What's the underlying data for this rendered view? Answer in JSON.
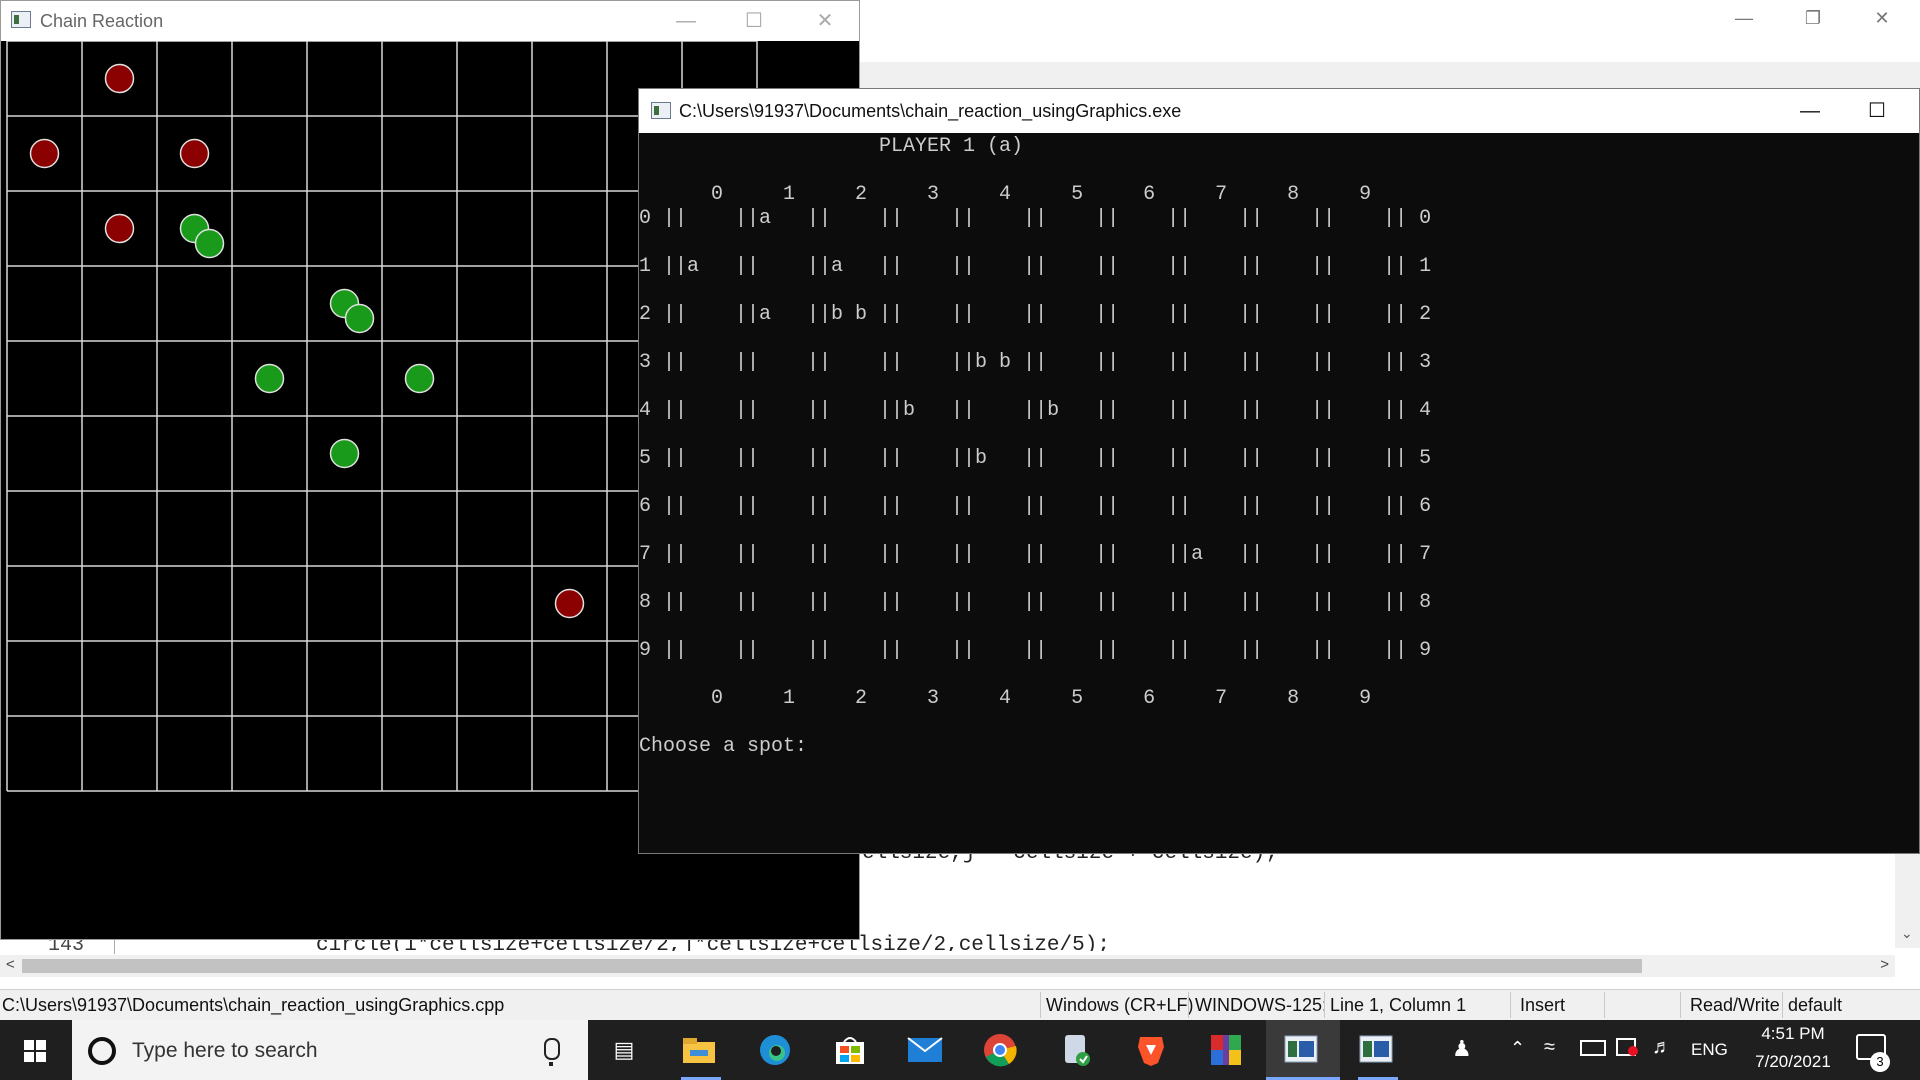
{
  "ide": {
    "code_fragment_top": "ellsize,j * cellsize + cellsize);",
    "code_line_number": "143",
    "code_fragment_bottom": "circle(i*cellsize+cellsize/2,j*cellsize+cellsize/2,cellsize/5);",
    "status": {
      "file_path": "C:\\Users\\91937\\Documents\\chain_reaction_usingGraphics.cpp",
      "line_endings": "Windows (CR+LF)",
      "encoding": "WINDOWS-125:",
      "position": "Line 1, Column 1",
      "mode": "Insert",
      "access": "Read/Write",
      "profile": "default"
    }
  },
  "game_window": {
    "title": "Chain Reaction",
    "grid_size": 10,
    "colors": {
      "background": "#000000",
      "grid": "#d8d8d8",
      "player_a": "#8b0000",
      "player_b": "#1a9a1a",
      "orb_outline": "#e0e0e0"
    },
    "cells": [
      {
        "row": 0,
        "col": 1,
        "player": "a",
        "count": 1
      },
      {
        "row": 1,
        "col": 0,
        "player": "a",
        "count": 1
      },
      {
        "row": 1,
        "col": 2,
        "player": "a",
        "count": 1
      },
      {
        "row": 2,
        "col": 1,
        "player": "a",
        "count": 1
      },
      {
        "row": 2,
        "col": 2,
        "player": "b",
        "count": 2
      },
      {
        "row": 3,
        "col": 4,
        "player": "b",
        "count": 2
      },
      {
        "row": 4,
        "col": 3,
        "player": "b",
        "count": 1
      },
      {
        "row": 4,
        "col": 5,
        "player": "b",
        "count": 1
      },
      {
        "row": 5,
        "col": 4,
        "player": "b",
        "count": 1
      },
      {
        "row": 7,
        "col": 7,
        "player": "a",
        "count": 1
      }
    ]
  },
  "console": {
    "title": "C:\\Users\\91937\\Documents\\chain_reaction_usingGraphics.exe",
    "lines": [
      "                    PLAYER 1 (a)",
      "",
      "      0     1     2     3     4     5     6     7     8     9",
      "0 ||    ||a   ||    ||    ||    ||    ||    ||    ||    ||    || 0",
      "",
      "1 ||a   ||    ||a   ||    ||    ||    ||    ||    ||    ||    || 1",
      "",
      "2 ||    ||a   ||b b ||    ||    ||    ||    ||    ||    ||    || 2",
      "",
      "3 ||    ||    ||    ||    ||b b ||    ||    ||    ||    ||    || 3",
      "",
      "4 ||    ||    ||    ||b   ||    ||b   ||    ||    ||    ||    || 4",
      "",
      "5 ||    ||    ||    ||    ||b   ||    ||    ||    ||    ||    || 5",
      "",
      "6 ||    ||    ||    ||    ||    ||    ||    ||    ||    ||    || 6",
      "",
      "7 ||    ||    ||    ||    ||    ||    ||    ||a   ||    ||    || 7",
      "",
      "8 ||    ||    ||    ||    ||    ||    ||    ||    ||    ||    || 8",
      "",
      "9 ||    ||    ||    ||    ||    ||    ||    ||    ||    ||    || 9",
      "",
      "      0     1     2     3     4     5     6     7     8     9",
      "",
      "Choose a spot:"
    ]
  },
  "taskbar": {
    "search_placeholder": "Type here to search",
    "apps": [
      "task-view",
      "file-explorer",
      "edge",
      "microsoft-store",
      "mail",
      "chrome",
      "app-installer",
      "brave",
      "winrar",
      "chain-reaction-graphics",
      "console"
    ],
    "tray": {
      "language": "ENG",
      "time": "4:51 PM",
      "date": "7/20/2021",
      "notification_count": "3"
    }
  }
}
